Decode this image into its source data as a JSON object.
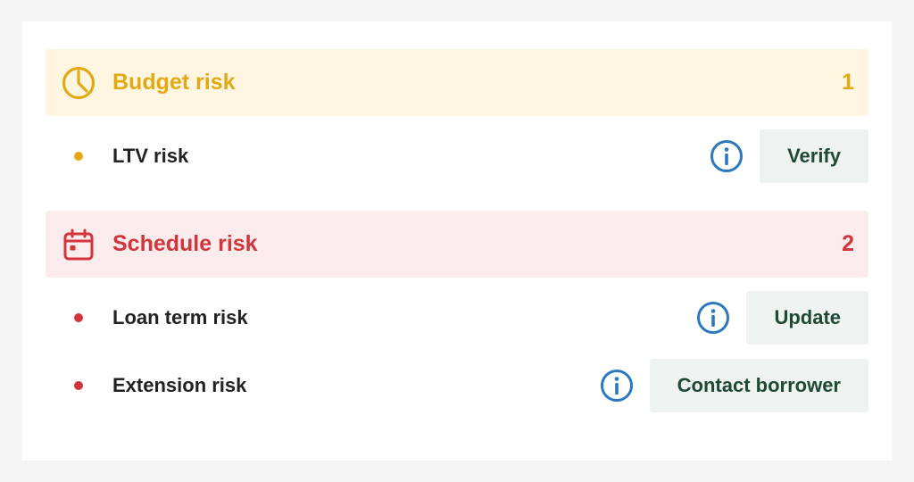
{
  "colors": {
    "budget_accent": "#e3a915",
    "budget_bg": "#fff6e2",
    "schedule_accent": "#d2353b",
    "schedule_bg": "#fdeced",
    "info_icon": "#2a78c0",
    "button_bg": "#eef2f0",
    "button_text": "#1e4a33"
  },
  "groups": [
    {
      "title": "Budget risk",
      "count": "1",
      "icon": "pie-chart-icon",
      "items": [
        {
          "label": "LTV risk",
          "action": "Verify"
        }
      ]
    },
    {
      "title": "Schedule risk",
      "count": "2",
      "icon": "calendar-icon",
      "items": [
        {
          "label": "Loan term risk",
          "action": "Update"
        },
        {
          "label": "Extension risk",
          "action": "Contact borrower"
        }
      ]
    }
  ]
}
